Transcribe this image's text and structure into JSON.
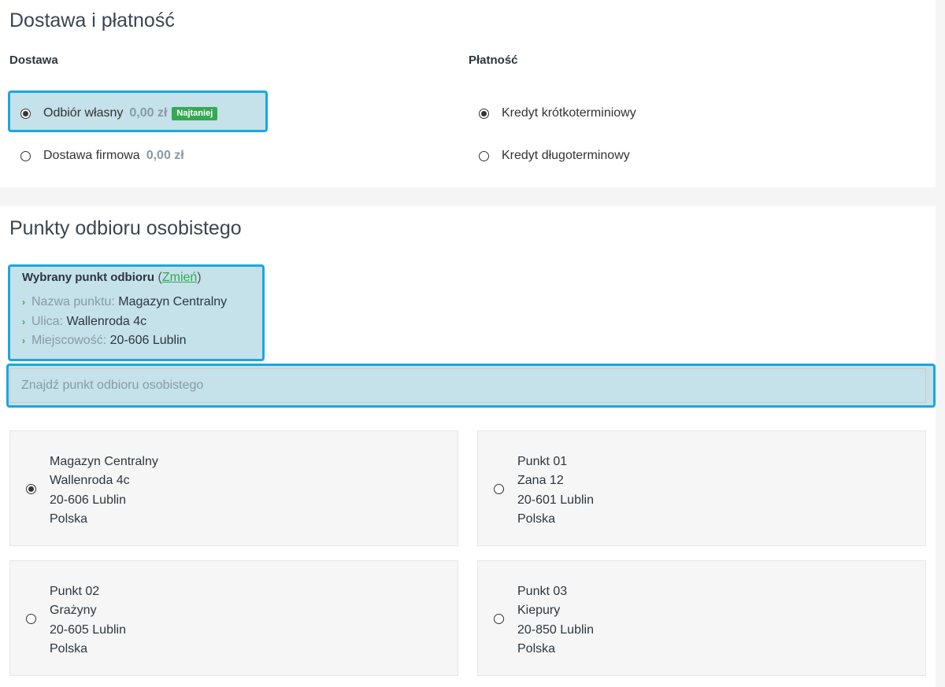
{
  "delivery_section": {
    "title": "Dostawa i płatność",
    "delivery_header": "Dostawa",
    "payment_header": "Płatność",
    "delivery_options": [
      {
        "label": "Odbiór własny",
        "price": "0,00 zł",
        "badge": "Najtaniej",
        "selected": true
      },
      {
        "label": "Dostawa firmowa",
        "price": "0,00 zł",
        "selected": false
      }
    ],
    "payment_options": [
      {
        "label": "Kredyt krótkoterminiowy",
        "selected": true
      },
      {
        "label": "Kredyt długoterminowy",
        "selected": false
      }
    ]
  },
  "pickup_section": {
    "title": "Punkty odbioru osobistego",
    "selected": {
      "heading": "Wybrany punkt odbioru",
      "paren_open": "(",
      "change_link": "Zmień",
      "paren_close": ")",
      "fields": [
        {
          "key": "Nazwa punktu:",
          "value": "Magazyn Centralny"
        },
        {
          "key": "Ulica:",
          "value": "Wallenroda 4c"
        },
        {
          "key": "Miejscowość:",
          "value": "20-606 Lublin"
        }
      ]
    },
    "search_placeholder": "Znajdź punkt odbioru osobistego",
    "points": [
      {
        "name": "Magazyn Centralny",
        "street": "Wallenroda 4c",
        "city": "20-606 Lublin",
        "country": "Polska",
        "selected": true
      },
      {
        "name": "Punkt 01",
        "street": "Zana 12",
        "city": "20-601 Lublin",
        "country": "Polska",
        "selected": false
      },
      {
        "name": "Punkt 02",
        "street": "Grażyny",
        "city": "20-605 Lublin",
        "country": "Polska",
        "selected": false
      },
      {
        "name": "Punkt 03",
        "street": "Kiepury",
        "city": "20-850 Lublin",
        "country": "Polska",
        "selected": false
      }
    ]
  },
  "colors": {
    "highlight_border": "#1aa8de",
    "highlight_fill": "#c5e1e9",
    "accent_green": "#34a853",
    "muted_text": "#8a99a8"
  }
}
